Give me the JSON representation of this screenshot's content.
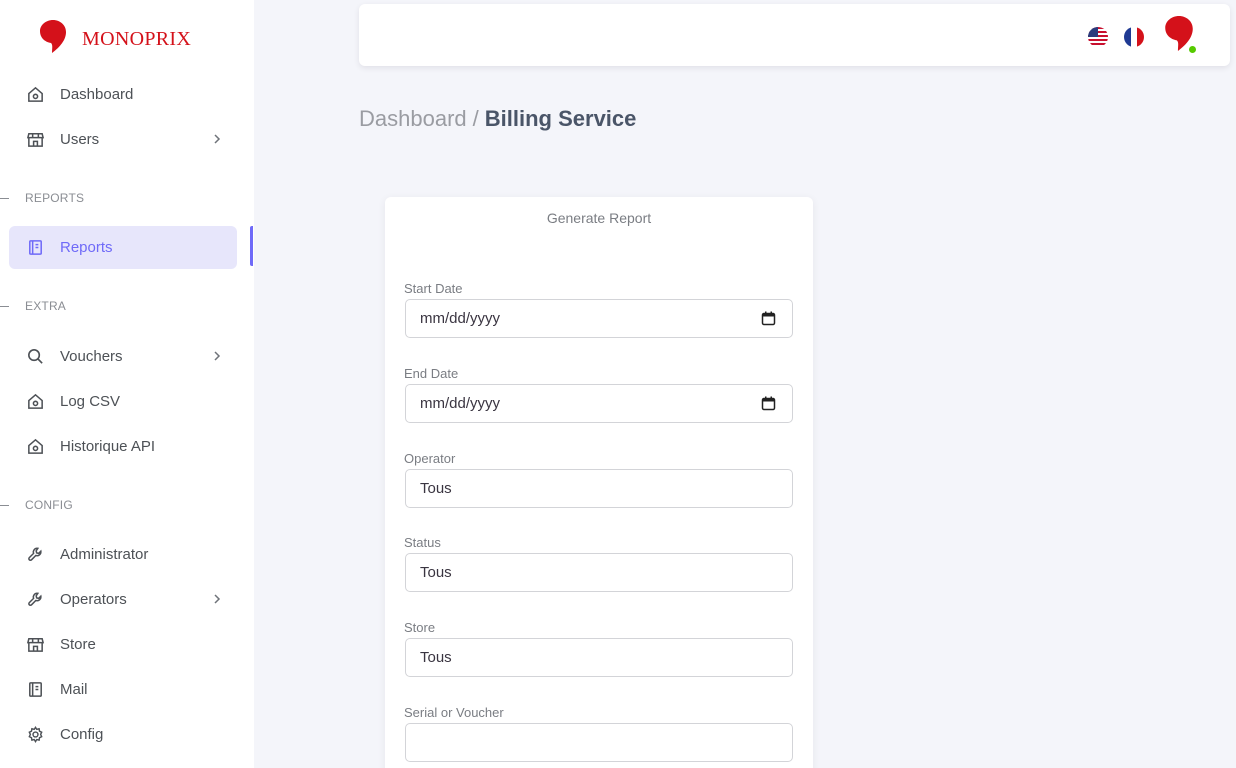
{
  "brand": {
    "name": "MONOPRIX",
    "color": "#d4111a"
  },
  "sidebar": {
    "items": [
      {
        "label": "Dashboard",
        "icon": "home-icon"
      },
      {
        "label": "Users",
        "icon": "store-icon",
        "has_submenu": true
      },
      {
        "label": "Reports",
        "icon": "notebook-icon",
        "active": true
      },
      {
        "label": "Vouchers",
        "icon": "search-icon",
        "has_submenu": true
      },
      {
        "label": "Log CSV",
        "icon": "home-icon"
      },
      {
        "label": "Historique API",
        "icon": "home-icon"
      },
      {
        "label": "Administrator",
        "icon": "wrench-icon"
      },
      {
        "label": "Operators",
        "icon": "wrench-icon",
        "has_submenu": true
      },
      {
        "label": "Store",
        "icon": "store-icon"
      },
      {
        "label": "Mail",
        "icon": "notebook-icon"
      },
      {
        "label": "Config",
        "icon": "gear-icon"
      }
    ],
    "sections": [
      "REPORTS",
      "EXTRA",
      "CONFIG"
    ]
  },
  "topbar": {
    "flags": [
      "us-flag-icon",
      "france-flag-icon"
    ],
    "avatar_status": "online"
  },
  "breadcrumb": {
    "parent": "Dashboard",
    "separator": "/",
    "current": "Billing Service"
  },
  "report_form": {
    "title": "Generate Report",
    "fields": [
      {
        "label": "Start Date",
        "value": "mm/dd/yyyy"
      },
      {
        "label": "End Date",
        "value": "mm/dd/yyyy"
      },
      {
        "label": "Operator",
        "value": "Tous"
      },
      {
        "label": "Status",
        "value": "Tous"
      },
      {
        "label": "Store",
        "value": "Tous"
      },
      {
        "label": "Serial or Voucher",
        "value": ""
      }
    ]
  },
  "colors": {
    "accent": "#6f6af8",
    "active_bg": "#e7e6fb",
    "online": "#56ca00"
  }
}
